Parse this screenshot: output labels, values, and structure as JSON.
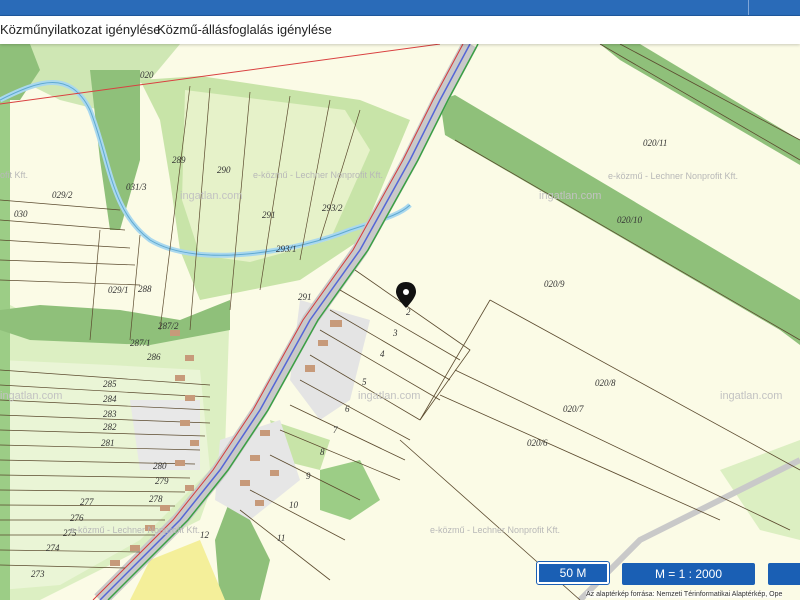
{
  "header": {
    "accent": "#2a6bb8"
  },
  "tabs": [
    {
      "label": "Közműnyilatkozat igénylése"
    },
    {
      "label": "Közmű-állásfoglalás igénylése"
    }
  ],
  "map": {
    "parcels": [
      "020",
      "289",
      "290",
      "291",
      "293/2",
      "293/1",
      "291",
      "031/3",
      "029/2",
      "030",
      "029/1",
      "288",
      "287/1",
      "287/2",
      "286",
      "285",
      "284",
      "283",
      "282",
      "281",
      "280",
      "279",
      "278",
      "277",
      "276",
      "275",
      "274",
      "273",
      "020/11",
      "020/10",
      "020/9",
      "020/8",
      "020/7",
      "020/6",
      "2",
      "3",
      "4",
      "5",
      "6",
      "7",
      "8",
      "9",
      "10",
      "11",
      "12"
    ],
    "watermarks": [
      "e-közmű - Lechner Nonprofit Kft.",
      "ingatlan.com"
    ],
    "marker": "location-pin"
  },
  "controls": {
    "scale_label": "50 M",
    "zoom_label": "M = 1 : 2000"
  },
  "attribution": "Az alaptérkép forrása: Nemzeti Térinformatikai Alaptérkép, Ope"
}
